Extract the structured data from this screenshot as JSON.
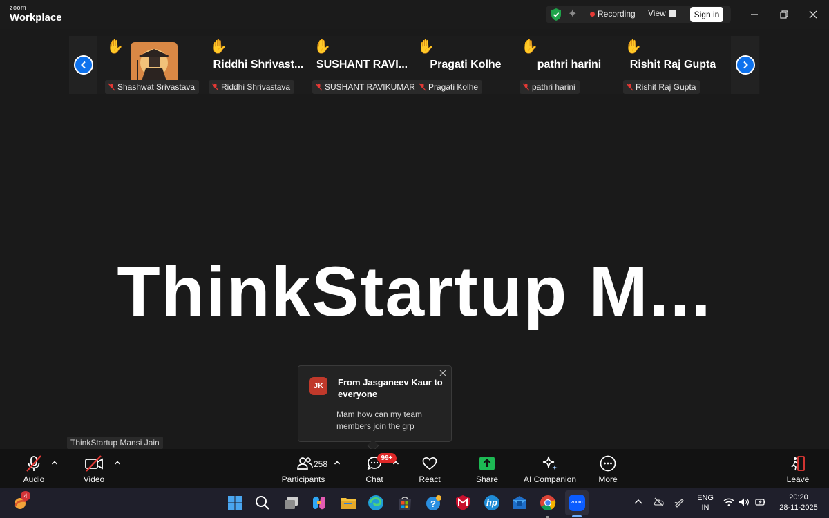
{
  "titlebar": {
    "brand_small": "zoom",
    "brand_large": "Workplace",
    "recording_label": "Recording",
    "view_label": "View",
    "signin_label": "Sign in"
  },
  "gallery": {
    "tiles": [
      {
        "display": "",
        "chip": "Shashwat Srivastava",
        "has_avatar": true
      },
      {
        "display": "Riddhi  Shrivast...",
        "chip": "Riddhi Shrivastava"
      },
      {
        "display": "SUSHANT  RAVI...",
        "chip": "SUSHANT RAVIKUMAR"
      },
      {
        "display": "Pragati Kolhe",
        "chip": "Pragati Kolhe"
      },
      {
        "display": "pathri harini",
        "chip": "pathri harini"
      },
      {
        "display": "Rishit Raj Gupta",
        "chip": "Rishit Raj Gupta"
      }
    ],
    "raised_hand_icon": "✋"
  },
  "share": {
    "title": "ThinkStartup M..."
  },
  "chat_popup": {
    "initials": "JK",
    "from": "From Jasganeev Kaur to everyone",
    "message": "Mam how can my team members join the grp"
  },
  "host_label": "ThinkStartup Mansi Jain",
  "toolbar": {
    "audio": "Audio",
    "video": "Video",
    "participants": "Participants",
    "participants_count": "258",
    "chat": "Chat",
    "chat_badge": "99+",
    "react": "React",
    "share": "Share",
    "ai_companion": "AI Companion",
    "more": "More",
    "leave": "Leave"
  },
  "taskbar": {
    "widgets_badge": "4",
    "lang_line1": "ENG",
    "lang_line2": "IN",
    "time": "20:20",
    "date": "28-11-2025",
    "zoom_icon_text": "zoom",
    "hp_text": "hp"
  },
  "colors": {
    "accent_blue": "#0e72ed",
    "record_red": "#e53935",
    "share_green": "#1db954",
    "badge_red": "#e02828"
  }
}
